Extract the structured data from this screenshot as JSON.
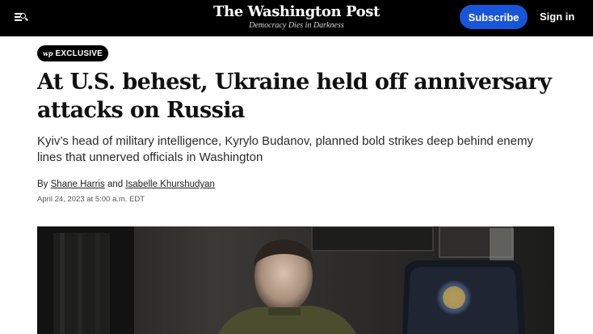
{
  "header": {
    "logo": "The Washington Post",
    "tagline": "Democracy Dies in Darkness",
    "menu_icon": "menu-search-icon",
    "subscribe_label": "Subscribe",
    "signin_label": "Sign in",
    "colors": {
      "background": "#000000",
      "subscribe": "#1955d8"
    }
  },
  "article": {
    "badge": {
      "logo": "wp",
      "label": "EXCLUSIVE"
    },
    "headline": "At U.S. behest, Ukraine held off anniversary attacks on Russia",
    "dek": "Kyiv’s head of military intelligence, Kyrylo Budanov, planned bold strikes deep behind enemy lines that unnerved officials in Washington",
    "byline": {
      "prefix": "By",
      "author1": "Shane Harris",
      "joiner": "and",
      "author2": "Isabelle Khurshudyan"
    },
    "date": "April 24, 2023 at 5:00 a.m. EDT"
  }
}
